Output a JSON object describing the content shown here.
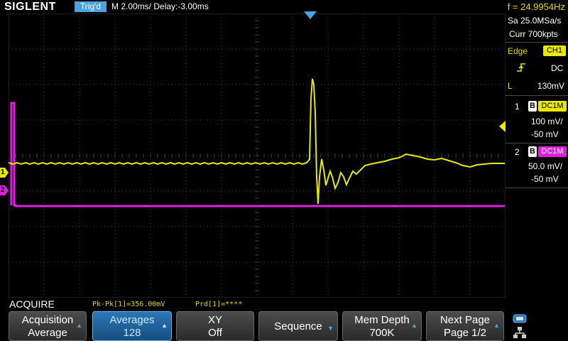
{
  "header": {
    "logo": "SIGLENT",
    "trigger_status": "Trig'd",
    "timebase": "M 2.00ms/ Delay:-3.00ms",
    "frequency": "f = 24.9954Hz"
  },
  "acquisition_info": {
    "sample_rate": "Sa 25.0MSa/s",
    "memory": "Curr 700kpts"
  },
  "trigger": {
    "type": "Edge",
    "source": "CH1",
    "slope_icon": "rising-edge-icon",
    "coupling": "DC",
    "level_label": "L",
    "level": "130mV"
  },
  "channels": [
    {
      "number": "1",
      "bw_flag": "B",
      "coupling": "DC1M",
      "scale": "100 mV/",
      "offset": "-50 mV",
      "color": "#e8e800"
    },
    {
      "number": "2",
      "bw_flag": "B",
      "coupling": "DC1M",
      "scale": "50.0 mV/",
      "offset": "-50 mV",
      "color": "#e020e0"
    }
  ],
  "markers": {
    "ch1": "1",
    "ch2": "2"
  },
  "status": {
    "menu_title": "ACQUIRE",
    "measurement_1": "Pk-Pk[1]=356.00mV",
    "measurement_2": "Prd[1]=****"
  },
  "softkeys": [
    {
      "line1": "Acquisition",
      "line2": "Average",
      "arrow": "▲",
      "active": false
    },
    {
      "line1": "Averages",
      "line2": "128",
      "arrow": "▲",
      "active": true
    },
    {
      "line1": "XY",
      "line2": "Off",
      "arrow": "",
      "active": false
    },
    {
      "line1": "Sequence",
      "line2": "",
      "arrow": "▼",
      "active": false
    },
    {
      "line1": "Mem Depth",
      "line2": "700K",
      "arrow": "▲",
      "active": false
    },
    {
      "line1": "Next Page",
      "line2": "Page 1/2",
      "arrow": "▲",
      "active": false
    }
  ],
  "icons": {
    "usb": "usb-icon",
    "network": "network-icon"
  },
  "colors": {
    "grid": "#3c3c3c",
    "ch1": "#e8e800",
    "ch2": "#e020e0",
    "accent": "#4aa3df"
  }
}
